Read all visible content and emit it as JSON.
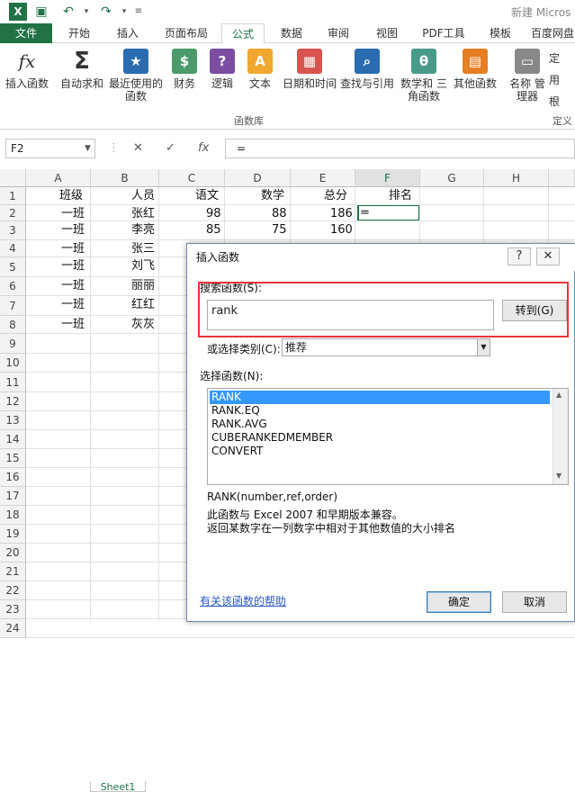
{
  "title_bar": {
    "app_title": "新建 Micros"
  },
  "tabs": [
    "文件",
    "开始",
    "插入",
    "页面布局",
    "公式",
    "数据",
    "审阅",
    "视图",
    "PDF工具",
    "模板",
    "百度网盘"
  ],
  "ribbon": {
    "buttons": [
      {
        "label": "插入函数",
        "icon": "fx"
      },
      {
        "label": "自动求和",
        "icon": "Σ"
      },
      {
        "label": "最近使用的 函数",
        "icon": "★"
      },
      {
        "label": "财务",
        "icon": "$"
      },
      {
        "label": "逻辑",
        "icon": "?"
      },
      {
        "label": "文本",
        "icon": "A"
      },
      {
        "label": "日期和时间",
        "icon": "▦"
      },
      {
        "label": "查找与引用",
        "icon": "⌕"
      },
      {
        "label": "数学和 三角函数",
        "icon": "θ"
      },
      {
        "label": "其他函数",
        "icon": "▤"
      },
      {
        "label": "名称 管理器",
        "icon": "▭"
      }
    ],
    "group_label": "函数库",
    "group_label_right": "定义",
    "side_items": [
      "定",
      "用",
      "根"
    ]
  },
  "formula_bar": {
    "name_box": "F2",
    "cancel": "✕",
    "enter": "✓",
    "fx": "fx",
    "formula": "="
  },
  "columns": [
    "A",
    "B",
    "C",
    "D",
    "E",
    "F",
    "G",
    "H"
  ],
  "rows": [
    "1",
    "2",
    "3",
    "4",
    "5",
    "6",
    "7",
    "8",
    "9",
    "10",
    "11",
    "12",
    "13",
    "14",
    "15",
    "16",
    "17",
    "18",
    "19",
    "20",
    "21",
    "22",
    "23",
    "24"
  ],
  "cells": {
    "header": [
      "班级",
      "人员",
      "语文",
      "数学",
      "总分",
      "排名"
    ],
    "classes": [
      "一班",
      "一班",
      "一班",
      "一班",
      "一班",
      "一班",
      "一班"
    ],
    "names": [
      "张红",
      "李亮",
      "张三",
      "刘飞",
      "丽丽",
      "红红",
      "灰灰"
    ],
    "chinese": [
      "98",
      "85"
    ],
    "math": [
      "88",
      "75"
    ],
    "total": [
      "186",
      "160"
    ],
    "rank_formula": "="
  },
  "sheet_tab": "Sheet1",
  "dialog": {
    "title": "插入函数",
    "help_btn": "?",
    "close_btn": "✕",
    "search_label": "搜索函数(S):",
    "search_value": "rank",
    "go_button": "转到(G)",
    "category_label": "或选择类别(C):",
    "category_value": "推荐",
    "select_label": "选择函数(N):",
    "functions": [
      "RANK",
      "RANK.EQ",
      "RANK.AVG",
      "CUBERANKEDMEMBER",
      "CONVERT"
    ],
    "selected_function": "RANK",
    "signature": "RANK(number,ref,order)",
    "desc1": "此函数与 Excel 2007 和早期版本兼容。",
    "desc2": "返回某数字在一列数字中相对于其他数值的大小排名",
    "help_link": "有关该函数的帮助",
    "ok": "确定",
    "cancel": "取消"
  },
  "colors": {
    "accent": "#217346",
    "highlight": "#e8353c",
    "selection": "#3399ff"
  }
}
